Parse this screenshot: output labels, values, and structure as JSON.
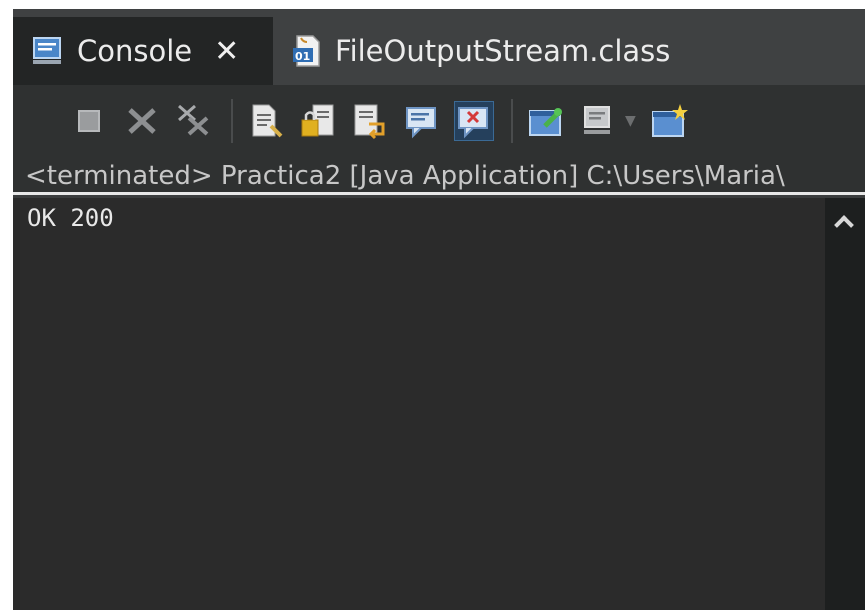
{
  "tabs": [
    {
      "label": "Console",
      "icon": "console-icon",
      "active": true
    },
    {
      "label": "FileOutputStream.class",
      "icon": "class-file-icon",
      "active": false
    }
  ],
  "toolbar": {
    "icons": [
      "terminate-icon",
      "remove-launch-icon",
      "remove-all-terminated-icon",
      "show-console-on-output-icon",
      "pin-console-icon",
      "word-wrap-icon",
      "scroll-lock-icon",
      "clear-console-icon",
      "display-selected-console-icon",
      "open-console-icon",
      "new-console-view-icon"
    ]
  },
  "status": "<terminated> Practica2 [Java Application] C:\\Users\\Maria\\",
  "console": {
    "output": "OK 200"
  },
  "colors": {
    "tab_active_bg": "#232525",
    "console_bg": "#2b2b2b",
    "toolbar_bg": "#2f3131",
    "text": "#e8e8e8"
  }
}
